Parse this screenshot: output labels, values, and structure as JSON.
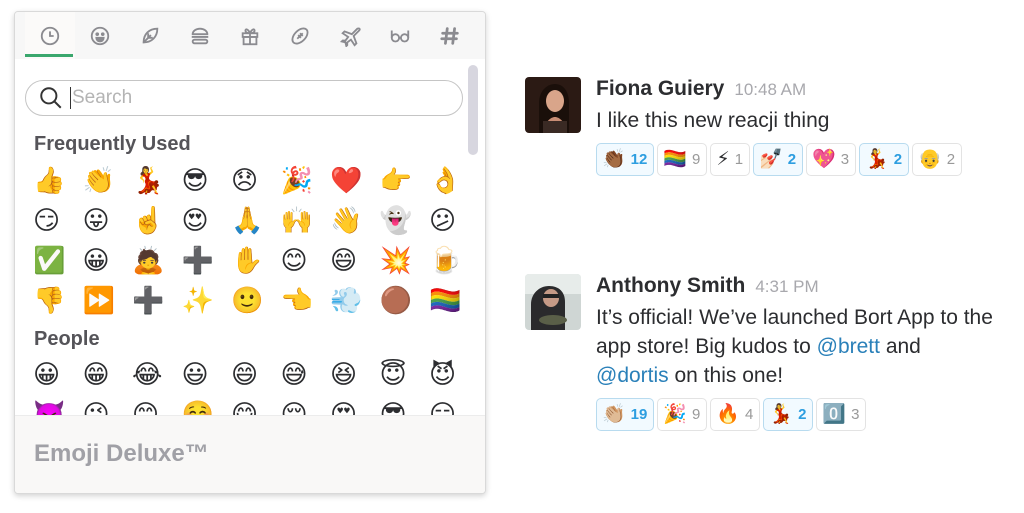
{
  "picker": {
    "tabs": [
      {
        "name": "recent",
        "icon": "clock-icon",
        "active": true
      },
      {
        "name": "people",
        "icon": "smiley-icon",
        "active": false
      },
      {
        "name": "nature",
        "icon": "leaf-icon",
        "active": false
      },
      {
        "name": "food",
        "icon": "burger-icon",
        "active": false
      },
      {
        "name": "celebration",
        "icon": "gift-icon",
        "active": false
      },
      {
        "name": "activity",
        "icon": "football-icon",
        "active": false
      },
      {
        "name": "travel",
        "icon": "airplane-icon",
        "active": false
      },
      {
        "name": "objects",
        "icon": "glasses-icon",
        "active": false
      },
      {
        "name": "custom",
        "icon": "slack-hash-icon",
        "active": false
      }
    ],
    "search": {
      "placeholder": "Search",
      "value": ""
    },
    "sections": [
      {
        "title": "Frequently Used",
        "emojis": [
          "👍",
          "👏",
          "💃",
          "😎",
          "😞",
          "🎉",
          "❤️",
          "👉",
          "👌",
          "😏",
          "😛",
          "☝️",
          "😍",
          "🙏",
          "🙌",
          "👋",
          "👻",
          "😕",
          "✅",
          "😀",
          "🙇",
          "➕",
          "✋",
          "😊",
          "😄",
          "💥",
          "🍺",
          "👎",
          "⏩",
          "➕",
          "✨",
          "🙂",
          "👈",
          "💨",
          "🟤",
          "🏳️‍🌈"
        ]
      },
      {
        "title": "People",
        "emojis": [
          "😀",
          "😁",
          "😂",
          "😃",
          "😄",
          "😅",
          "😆",
          "😇",
          "😈",
          "👿",
          "😉",
          "😊",
          "☺️",
          "😋",
          "😌",
          "😍",
          "😎",
          "😏"
        ]
      }
    ],
    "footer_title": "Emoji Deluxe™"
  },
  "messages": [
    {
      "author": "Fiona Guiery",
      "timestamp": "10:48 AM",
      "text": "I like this new reacji thing",
      "reactions": [
        {
          "emoji": "👏🏾",
          "count": "12",
          "mine": true
        },
        {
          "emoji": "🏳️‍🌈",
          "count": "9",
          "mine": false
        },
        {
          "emoji": "⚡",
          "count": "1",
          "mine": false
        },
        {
          "emoji": "💅🏻",
          "count": "2",
          "mine": true
        },
        {
          "emoji": "💖",
          "count": "3",
          "mine": false
        },
        {
          "emoji": "💃",
          "count": "2",
          "mine": true
        },
        {
          "emoji": "👴",
          "count": "2",
          "mine": false
        }
      ]
    },
    {
      "author": "Anthony Smith",
      "timestamp": "4:31 PM",
      "text_parts": [
        {
          "text": "It’s official! We’ve launched Bort App to the app store! Big kudos to ",
          "mention": false
        },
        {
          "text": "@brett",
          "mention": true
        },
        {
          "text": " and ",
          "mention": false
        },
        {
          "text": "@dortis",
          "mention": true
        },
        {
          "text": " on this one!",
          "mention": false
        }
      ],
      "reactions": [
        {
          "emoji": "👏🏼",
          "count": "19",
          "mine": true
        },
        {
          "emoji": "🎉",
          "count": "9",
          "mine": false
        },
        {
          "emoji": "🔥",
          "count": "4",
          "mine": false
        },
        {
          "emoji": "💃",
          "count": "2",
          "mine": true
        },
        {
          "emoji": "0️⃣",
          "count": "3",
          "mine": false
        }
      ]
    }
  ],
  "colors": {
    "active_tab_underline": "#3aa76d",
    "mention": "#2a80b9",
    "mine_reaction_count": "#2d9ee0",
    "mine_reaction_bg": "#f2faff"
  }
}
